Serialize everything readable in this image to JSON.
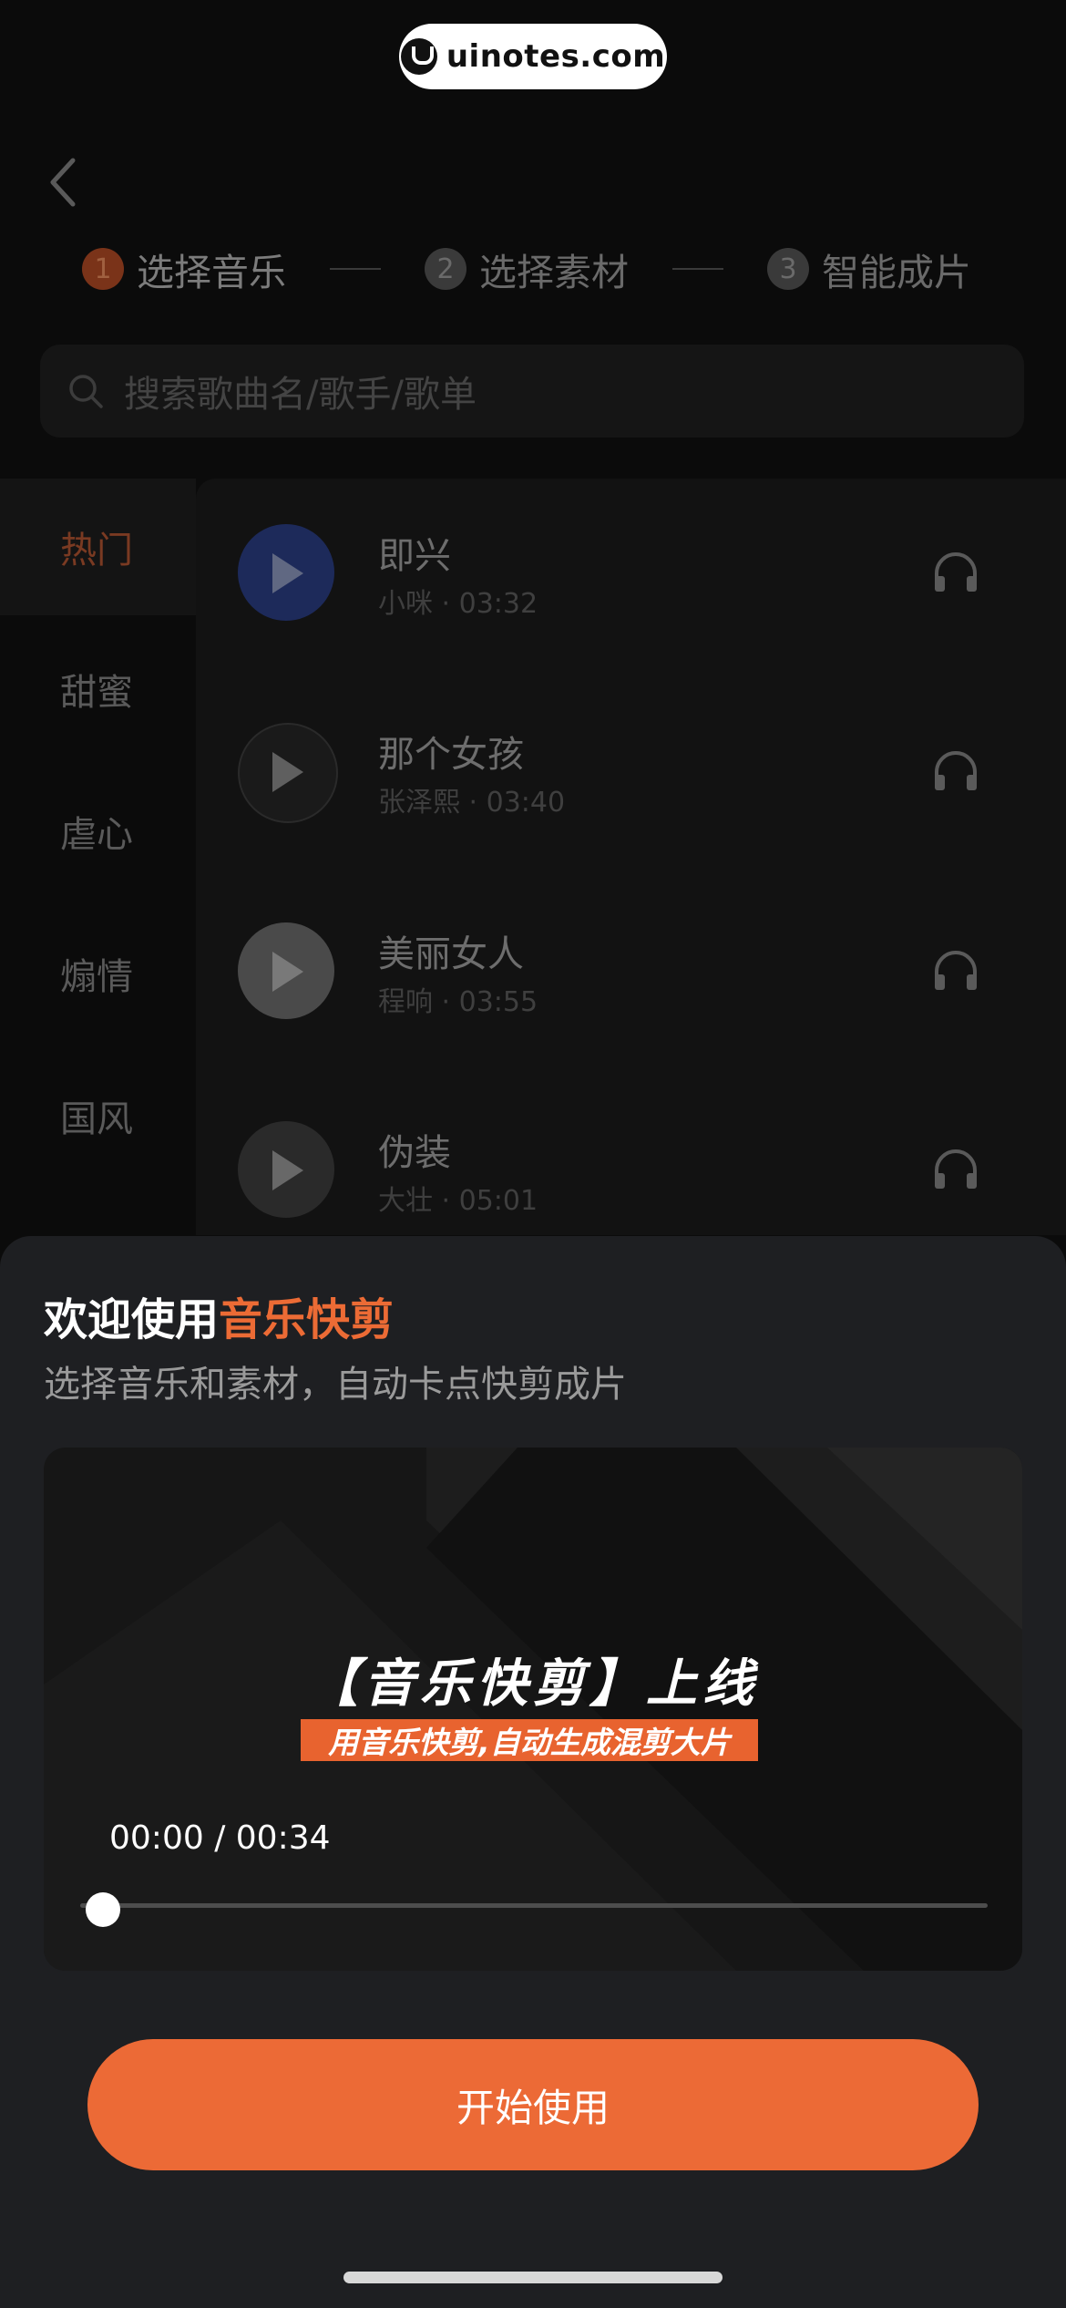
{
  "watermark": {
    "text": "uinotes.com"
  },
  "header": {
    "back_icon": "chevron-left-icon",
    "steps": [
      {
        "num": "1",
        "label": "选择音乐",
        "active": true
      },
      {
        "num": "2",
        "label": "选择素材",
        "active": false
      },
      {
        "num": "3",
        "label": "智能成片",
        "active": false
      }
    ]
  },
  "search": {
    "placeholder": "搜索歌曲名/歌手/歌单",
    "icon": "search-icon"
  },
  "categories": [
    {
      "label": "热门",
      "active": true
    },
    {
      "label": "甜蜜",
      "active": false
    },
    {
      "label": "虐心",
      "active": false
    },
    {
      "label": "煽情",
      "active": false
    },
    {
      "label": "国风",
      "active": false
    }
  ],
  "songs": [
    {
      "title": "即兴",
      "meta": "小咪 · 03:32",
      "cover_color": "#1d2a5a"
    },
    {
      "title": "那个女孩",
      "meta": "张泽熙 · 03:40",
      "cover_color": "#1a1a1a"
    },
    {
      "title": "美丽女人",
      "meta": "程响 · 03:55",
      "cover_color": "#4a4a4a"
    },
    {
      "title": "伪装",
      "meta": "大壮 · 05:01",
      "cover_color": "#2a2a2a"
    }
  ],
  "sheet": {
    "welcome_prefix": "欢迎使用",
    "welcome_accent": "音乐快剪",
    "subtitle": "选择音乐和素材，自动卡点快剪成片",
    "video": {
      "title": "【音乐快剪】上线",
      "subtitle": "用音乐快剪,自动生成混剪大片",
      "time": "00:00 / 00:34",
      "progress": 0
    },
    "cta_label": "开始使用"
  },
  "colors": {
    "accent": "#ec6a36",
    "sheet_bg": "#1e1f22"
  }
}
